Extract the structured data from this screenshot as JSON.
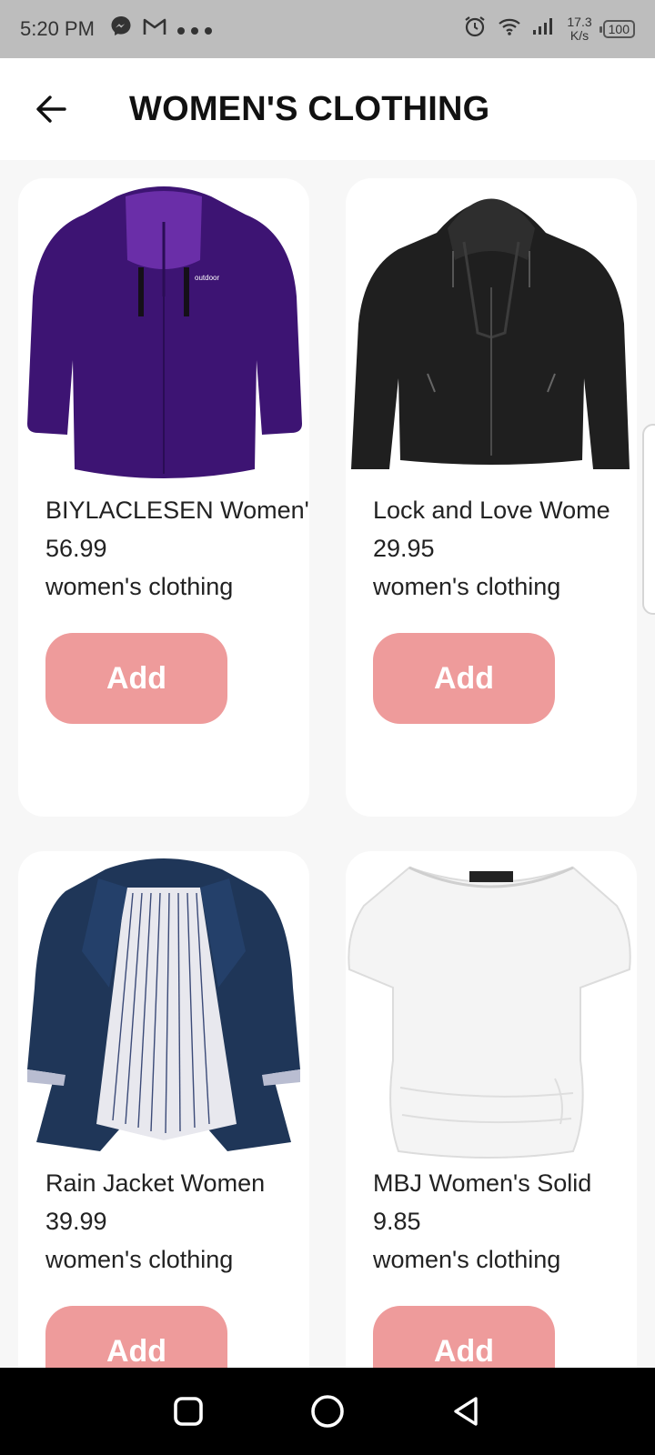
{
  "status_bar": {
    "time": "5:20 PM",
    "notification_icons": [
      "messenger-icon",
      "gmail-icon",
      "more-dots-icon"
    ],
    "network_speed_value": "17.3",
    "network_speed_unit": "K/s",
    "battery": "100"
  },
  "app_bar": {
    "title": "WOMEN'S CLOTHING",
    "back_icon": "arrow-left-icon"
  },
  "products": [
    {
      "name": "BIYLACLESEN Women'",
      "price": "56.99",
      "category": "women's clothing",
      "add_label": "Add",
      "image": "purple-jacket",
      "color": "#3d1473"
    },
    {
      "name": "Lock and Love Wome",
      "price": "29.95",
      "category": "women's clothing",
      "add_label": "Add",
      "image": "black-leather-jacket",
      "color": "#1f1f1f"
    },
    {
      "name": "Rain Jacket Women",
      "price": "39.99",
      "category": "women's clothing",
      "add_label": "Add",
      "image": "navy-rain-jacket",
      "color": "#1f3658"
    },
    {
      "name": "MBJ Women's Solid",
      "price": "9.85",
      "category": "women's clothing",
      "add_label": "Add",
      "image": "white-top",
      "color": "#f4f4f4"
    }
  ],
  "colors": {
    "add_button": "#ee9b9b",
    "status_bar": "#bdbdbd",
    "nav_bar": "#000000",
    "background": "#f7f7f7"
  },
  "nav_bar": {
    "buttons": [
      "recents-square-icon",
      "home-circle-icon",
      "back-triangle-icon"
    ]
  }
}
